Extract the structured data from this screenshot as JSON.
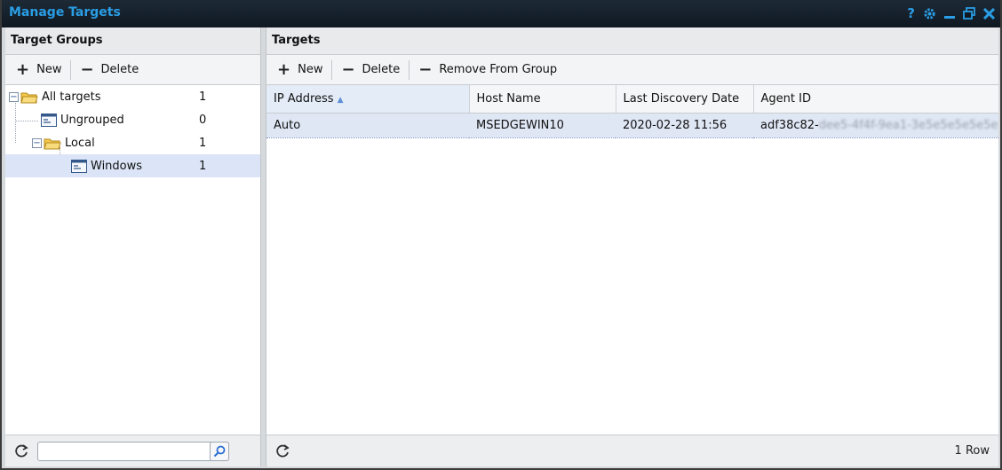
{
  "window": {
    "title": "Manage Targets",
    "controls": [
      "help-icon",
      "gear-icon",
      "minimize-icon",
      "restore-icon",
      "close-icon"
    ],
    "accent_color": "#2a9de4"
  },
  "left_panel": {
    "header": "Target Groups",
    "toolbar": {
      "new_label": "New",
      "delete_label": "Delete"
    },
    "tree": [
      {
        "label": "All targets",
        "count": "1"
      },
      {
        "label": "Ungrouped",
        "count": "0"
      },
      {
        "label": "Local",
        "count": "1"
      },
      {
        "label": "Windows",
        "count": "1"
      }
    ],
    "search": {
      "value": "",
      "placeholder": ""
    }
  },
  "right_panel": {
    "header": "Targets",
    "toolbar": {
      "new_label": "New",
      "delete_label": "Delete",
      "remove_label": "Remove From Group"
    },
    "columns": [
      "IP Address",
      "Host Name",
      "Last Discovery Date",
      "Agent ID"
    ],
    "sort_indicator": "▲",
    "rows": [
      {
        "ip": "Auto",
        "host": "MSEDGEWIN10",
        "date": "2020-02-28 11:56",
        "agent_prefix": "adf38c82-",
        "agent_redacted": "dee5-4f4f-9ea1-3e5e5e5e5e5e"
      }
    ],
    "row_count": "1 Row"
  }
}
